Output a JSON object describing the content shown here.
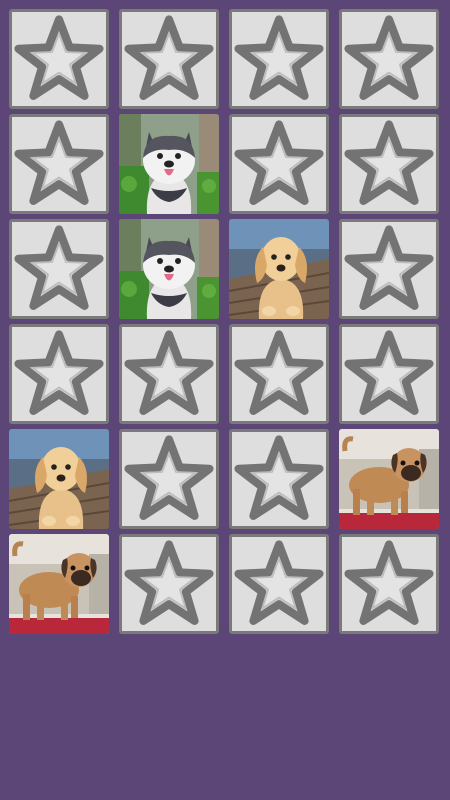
{
  "game": {
    "background_color": "#5b4677",
    "card_back_icon": "star-icon",
    "rows": [
      [
        {
          "state": "hidden"
        },
        {
          "state": "hidden"
        },
        {
          "state": "hidden"
        },
        {
          "state": "hidden"
        }
      ],
      [
        {
          "state": "hidden"
        },
        {
          "state": "revealed",
          "image": "husky-puppy"
        },
        {
          "state": "hidden"
        },
        {
          "state": "hidden"
        }
      ],
      [
        {
          "state": "hidden"
        },
        {
          "state": "revealed",
          "image": "husky-puppy"
        },
        {
          "state": "revealed",
          "image": "golden-puppy"
        },
        {
          "state": "hidden"
        }
      ],
      [
        {
          "state": "hidden"
        },
        {
          "state": "hidden"
        },
        {
          "state": "hidden"
        },
        {
          "state": "hidden"
        }
      ],
      [
        {
          "state": "revealed",
          "image": "golden-puppy"
        },
        {
          "state": "hidden"
        },
        {
          "state": "hidden"
        },
        {
          "state": "revealed",
          "image": "pug-puppy"
        }
      ],
      [
        {
          "state": "revealed",
          "image": "pug-puppy"
        },
        {
          "state": "hidden"
        },
        {
          "state": "hidden"
        },
        {
          "state": "hidden"
        }
      ]
    ]
  }
}
